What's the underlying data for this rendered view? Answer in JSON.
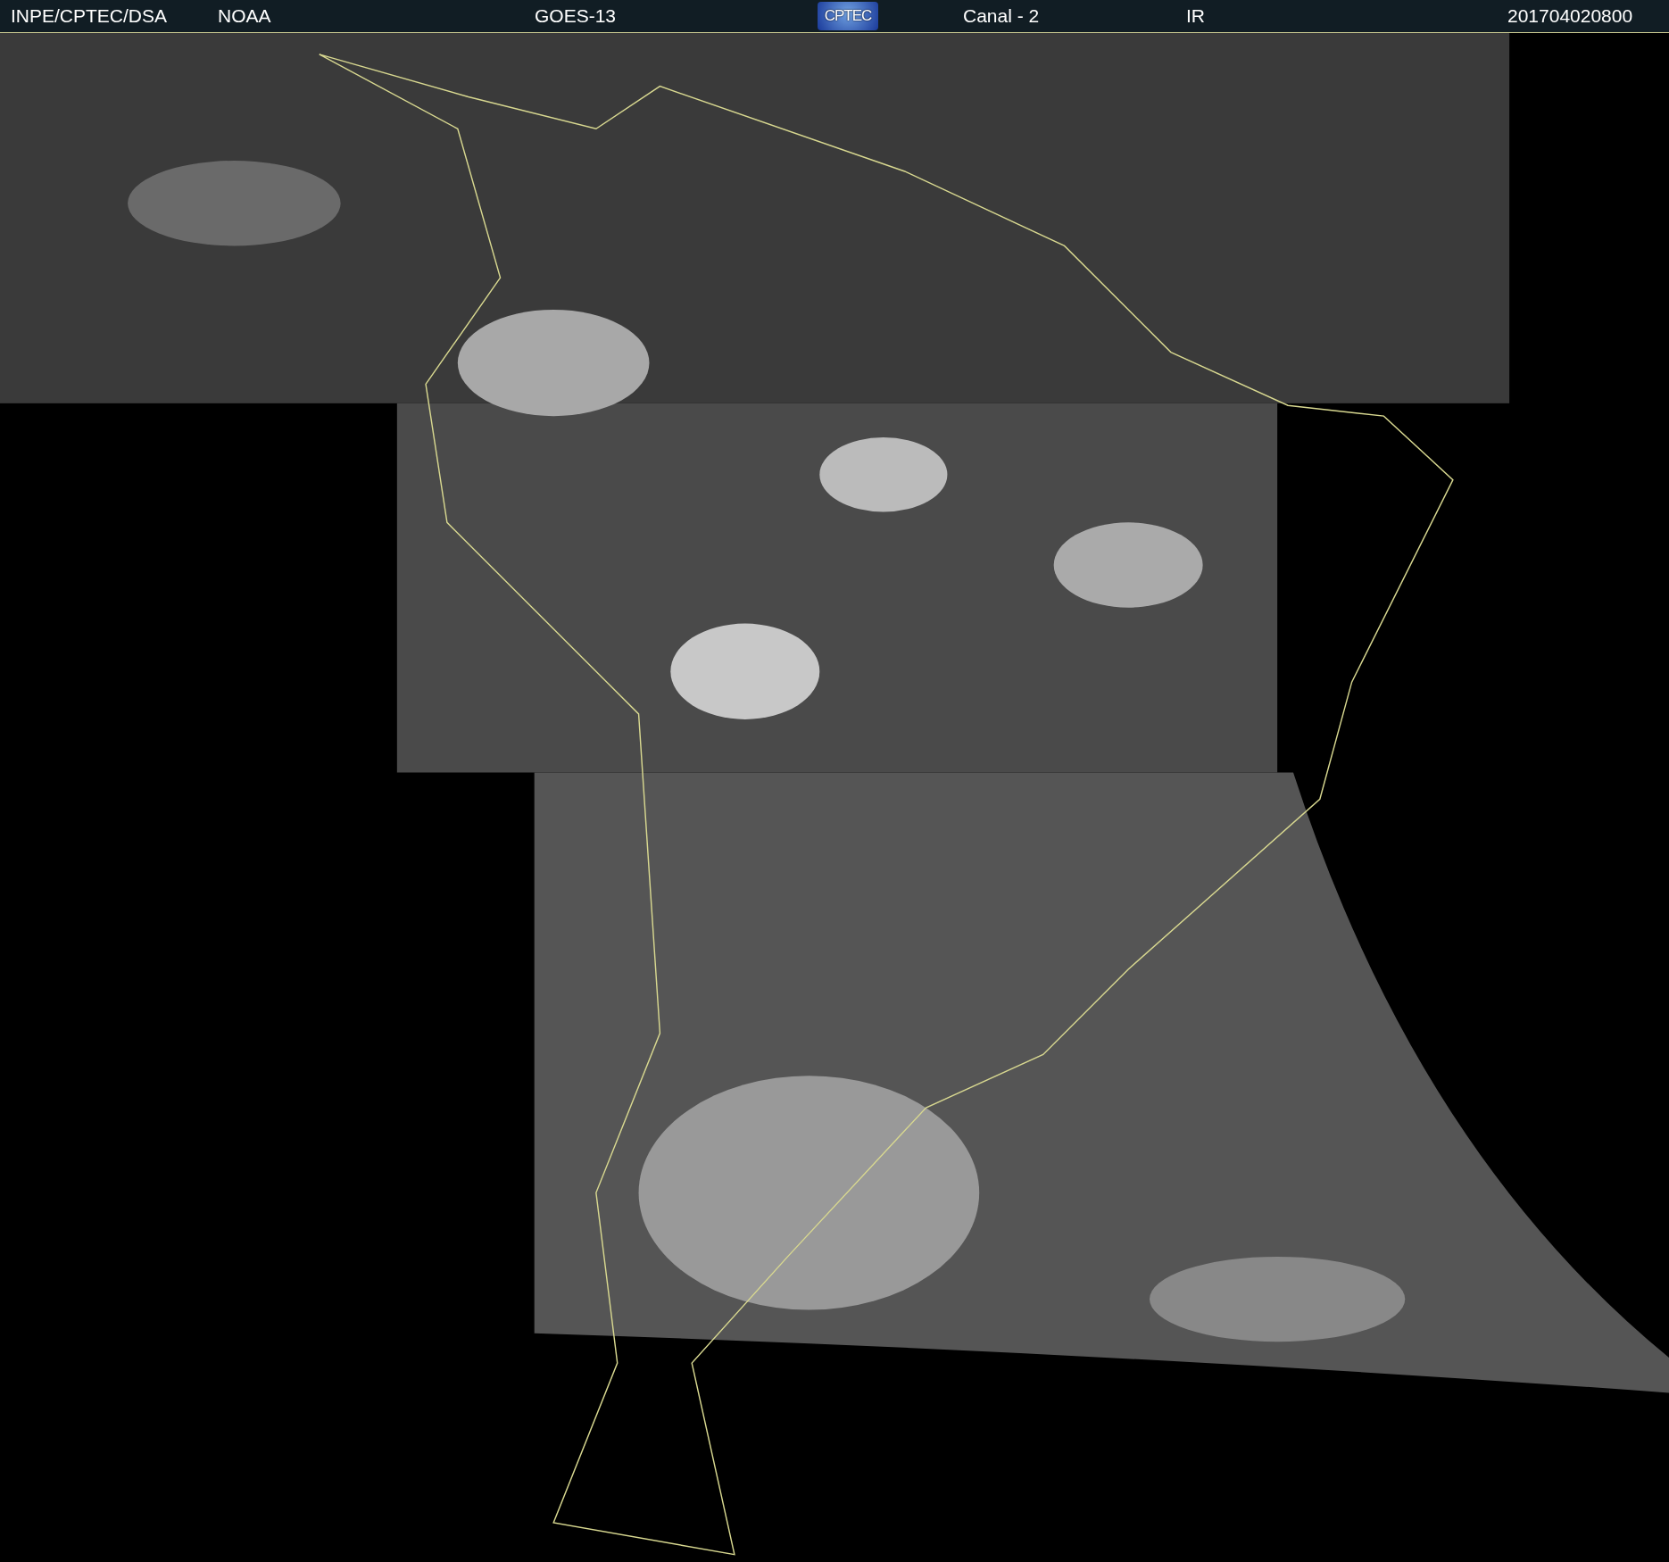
{
  "header": {
    "source": "INPE/CPTEC/DSA",
    "agency": "NOAA",
    "satellite": "GOES-13",
    "logo": "CPTEC",
    "channel": "Canal - 2",
    "band": "IR",
    "timestamp": "201704020800"
  }
}
